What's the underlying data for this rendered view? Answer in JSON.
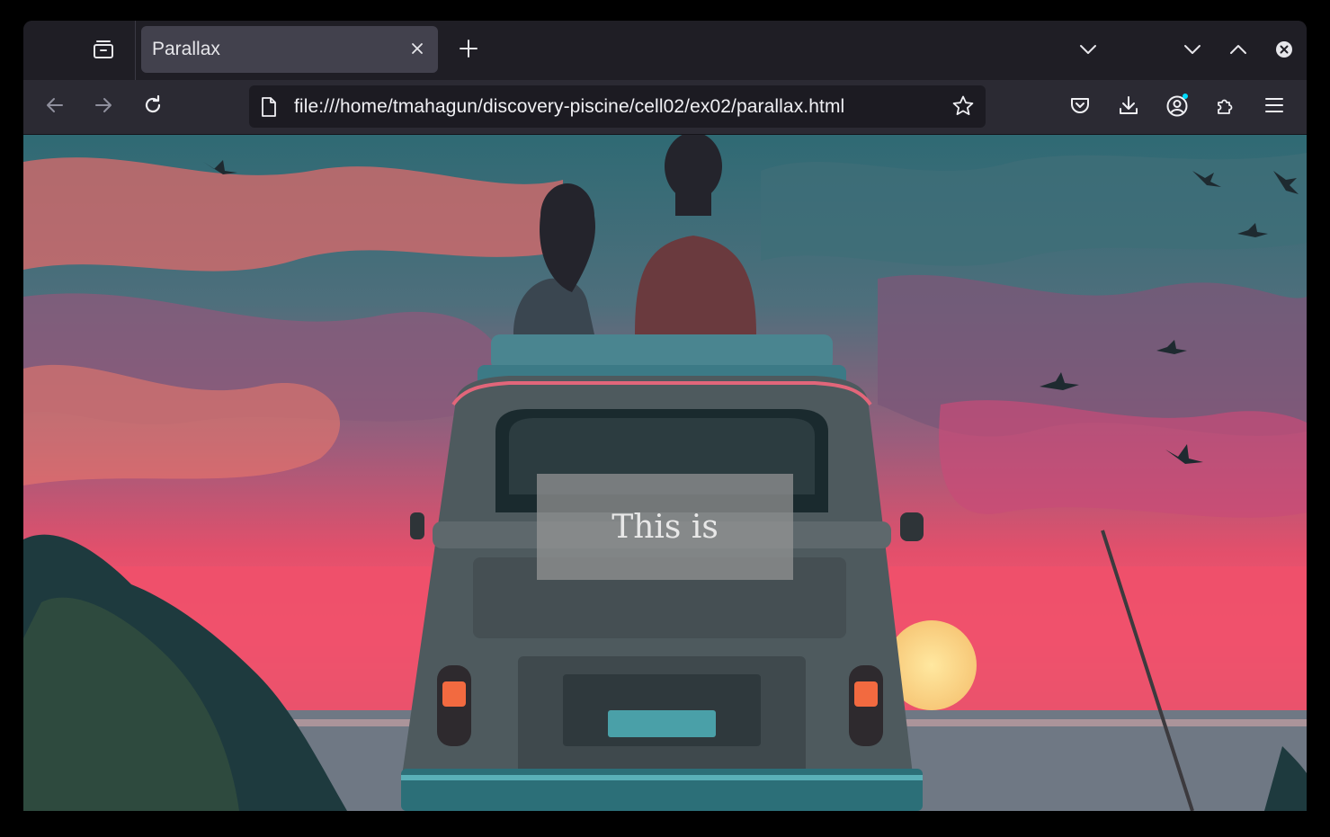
{
  "browser": {
    "tab": {
      "title": "Parallax"
    },
    "url": "file:///home/tmahagun/discovery-piscine/cell02/ex02/parallax.html"
  },
  "page": {
    "overlay_text": "This is"
  },
  "colors": {
    "tabbar_bg": "#1f1e25",
    "toolbar_bg": "#2b2a33",
    "urlbar_bg": "#1c1b22",
    "sky_teal": "#3a7078",
    "sunset_pink": "#e84f6a",
    "van_body": "#4f5a5e",
    "profile_dot": "#00ddff"
  },
  "icons": [
    "tab-list-icon",
    "close-icon",
    "plus-icon",
    "chevron-down-icon",
    "minimize-icon",
    "maximize-icon",
    "window-close-icon",
    "back-arrow-icon",
    "forward-arrow-icon",
    "reload-icon",
    "page-icon",
    "star-icon",
    "pocket-icon",
    "download-icon",
    "account-icon",
    "extensions-icon",
    "menu-icon"
  ]
}
